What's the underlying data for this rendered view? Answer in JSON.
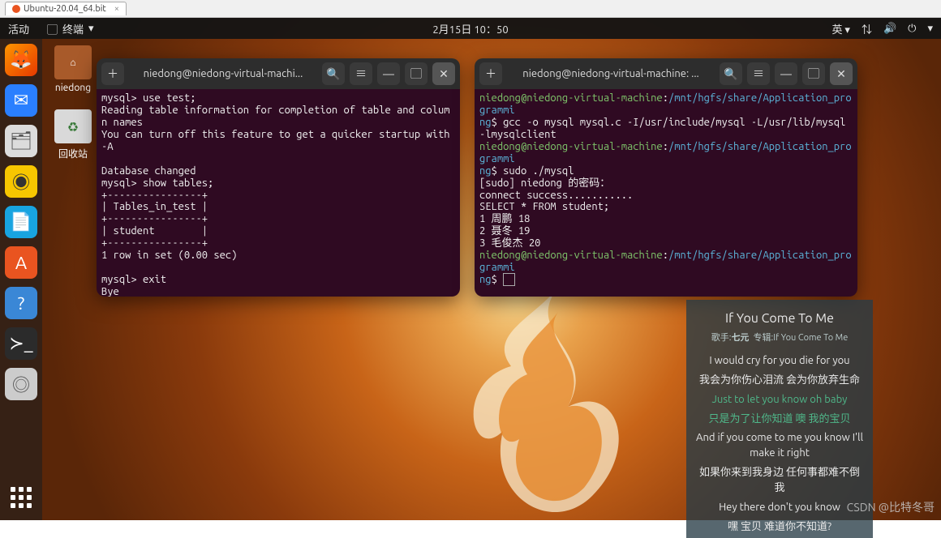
{
  "vm": {
    "tab_label": "Ubuntu-20.04_64.bit"
  },
  "topbar": {
    "activities": "活动",
    "app_label": "终端",
    "clock": "2月15日 10：50",
    "lang": "英"
  },
  "desktop_icons": {
    "home": "niedong",
    "trash": "回收站"
  },
  "term1": {
    "title": "niedong@niedong-virtual-machi...",
    "lines": "mysql> use test;\nReading table information for completion of table and column names\nYou can turn off this feature to get a quicker startup with -A\n\nDatabase changed\nmysql> show tables;\n+----------------+\n| Tables_in_test |\n+----------------+\n| student        |\n+----------------+\n1 row in set (0.00 sec)\n\nmysql> exit\nBye"
  },
  "term2": {
    "title": "niedong@niedong-virtual-machine: ...",
    "prompt_user": "niedong@niedong-virtual-machine",
    "prompt_path": "/mnt/hgfs/share/Application_programming",
    "cmd1": "gcc -o mysql mysql.c -I/usr/include/mysql -L/usr/lib/mysql -lmysqlclient",
    "cmd2": "sudo ./mysql",
    "out": "[sudo] niedong 的密码：\nconnect success...........\nSELECT * FROM student;\n1 周鹏 18\n2 聂冬 19\n3 毛俊杰 20"
  },
  "lyrics": {
    "title": "If You Come To Me",
    "artist_label": "歌手:",
    "artist": "七元",
    "album_label": "专辑:",
    "album": "If You Come To Me",
    "l1": "I would cry for you die for you",
    "l1c": "我会为你伤心泪流 会为你放弃生命",
    "l2": "Just to let you know oh baby",
    "l2c": "只是为了让你知道 噢 我的宝贝",
    "l3": "And if you come to me you know I'll make it right",
    "l3c": "如果你来到我身边 任何事都难不倒我",
    "l4": "Hey there don't you know",
    "l4c": "嘿 宝贝 难道你不知道?"
  },
  "watermark": "CSDN @比特冬哥"
}
